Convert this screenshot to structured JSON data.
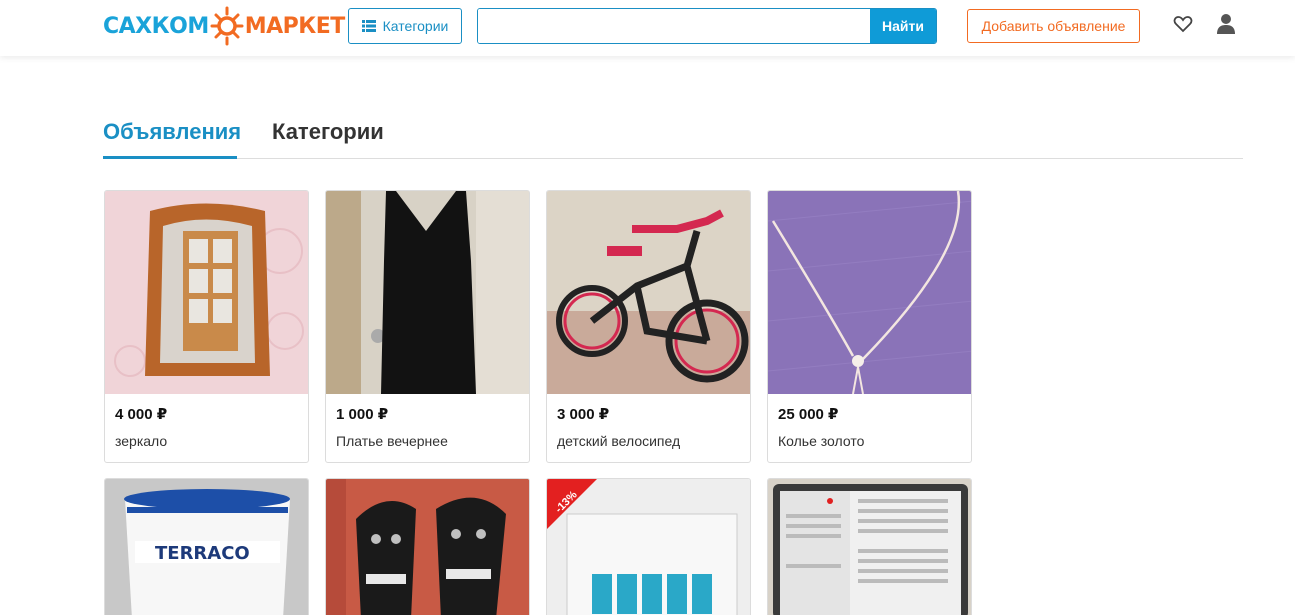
{
  "header": {
    "logo_left": "САХКОМ",
    "logo_right": "МАРКЕТ",
    "categories_button": "Категории",
    "search_placeholder": "",
    "search_button": "Найти",
    "add_listing_button": "Добавить объявление"
  },
  "tabs": [
    {
      "label": "Объявления",
      "active": true
    },
    {
      "label": "Категории",
      "active": false
    }
  ],
  "listings": [
    {
      "price": "4 000 ₽",
      "title": "зеркало"
    },
    {
      "price": "1 000 ₽",
      "title": "Платье вечернее"
    },
    {
      "price": "3 000 ₽",
      "title": "детский велосипед"
    },
    {
      "price": "25 000 ₽",
      "title": "Колье золото"
    }
  ],
  "second_row": [
    {
      "image_label": "TERRACO"
    },
    {
      "image_label": ""
    },
    {
      "badge": "-13%"
    },
    {
      "image_label": ""
    }
  ],
  "colors": {
    "brand_blue": "#1a8fc4",
    "brand_orange": "#f26b22",
    "discount_red": "#e32020"
  }
}
